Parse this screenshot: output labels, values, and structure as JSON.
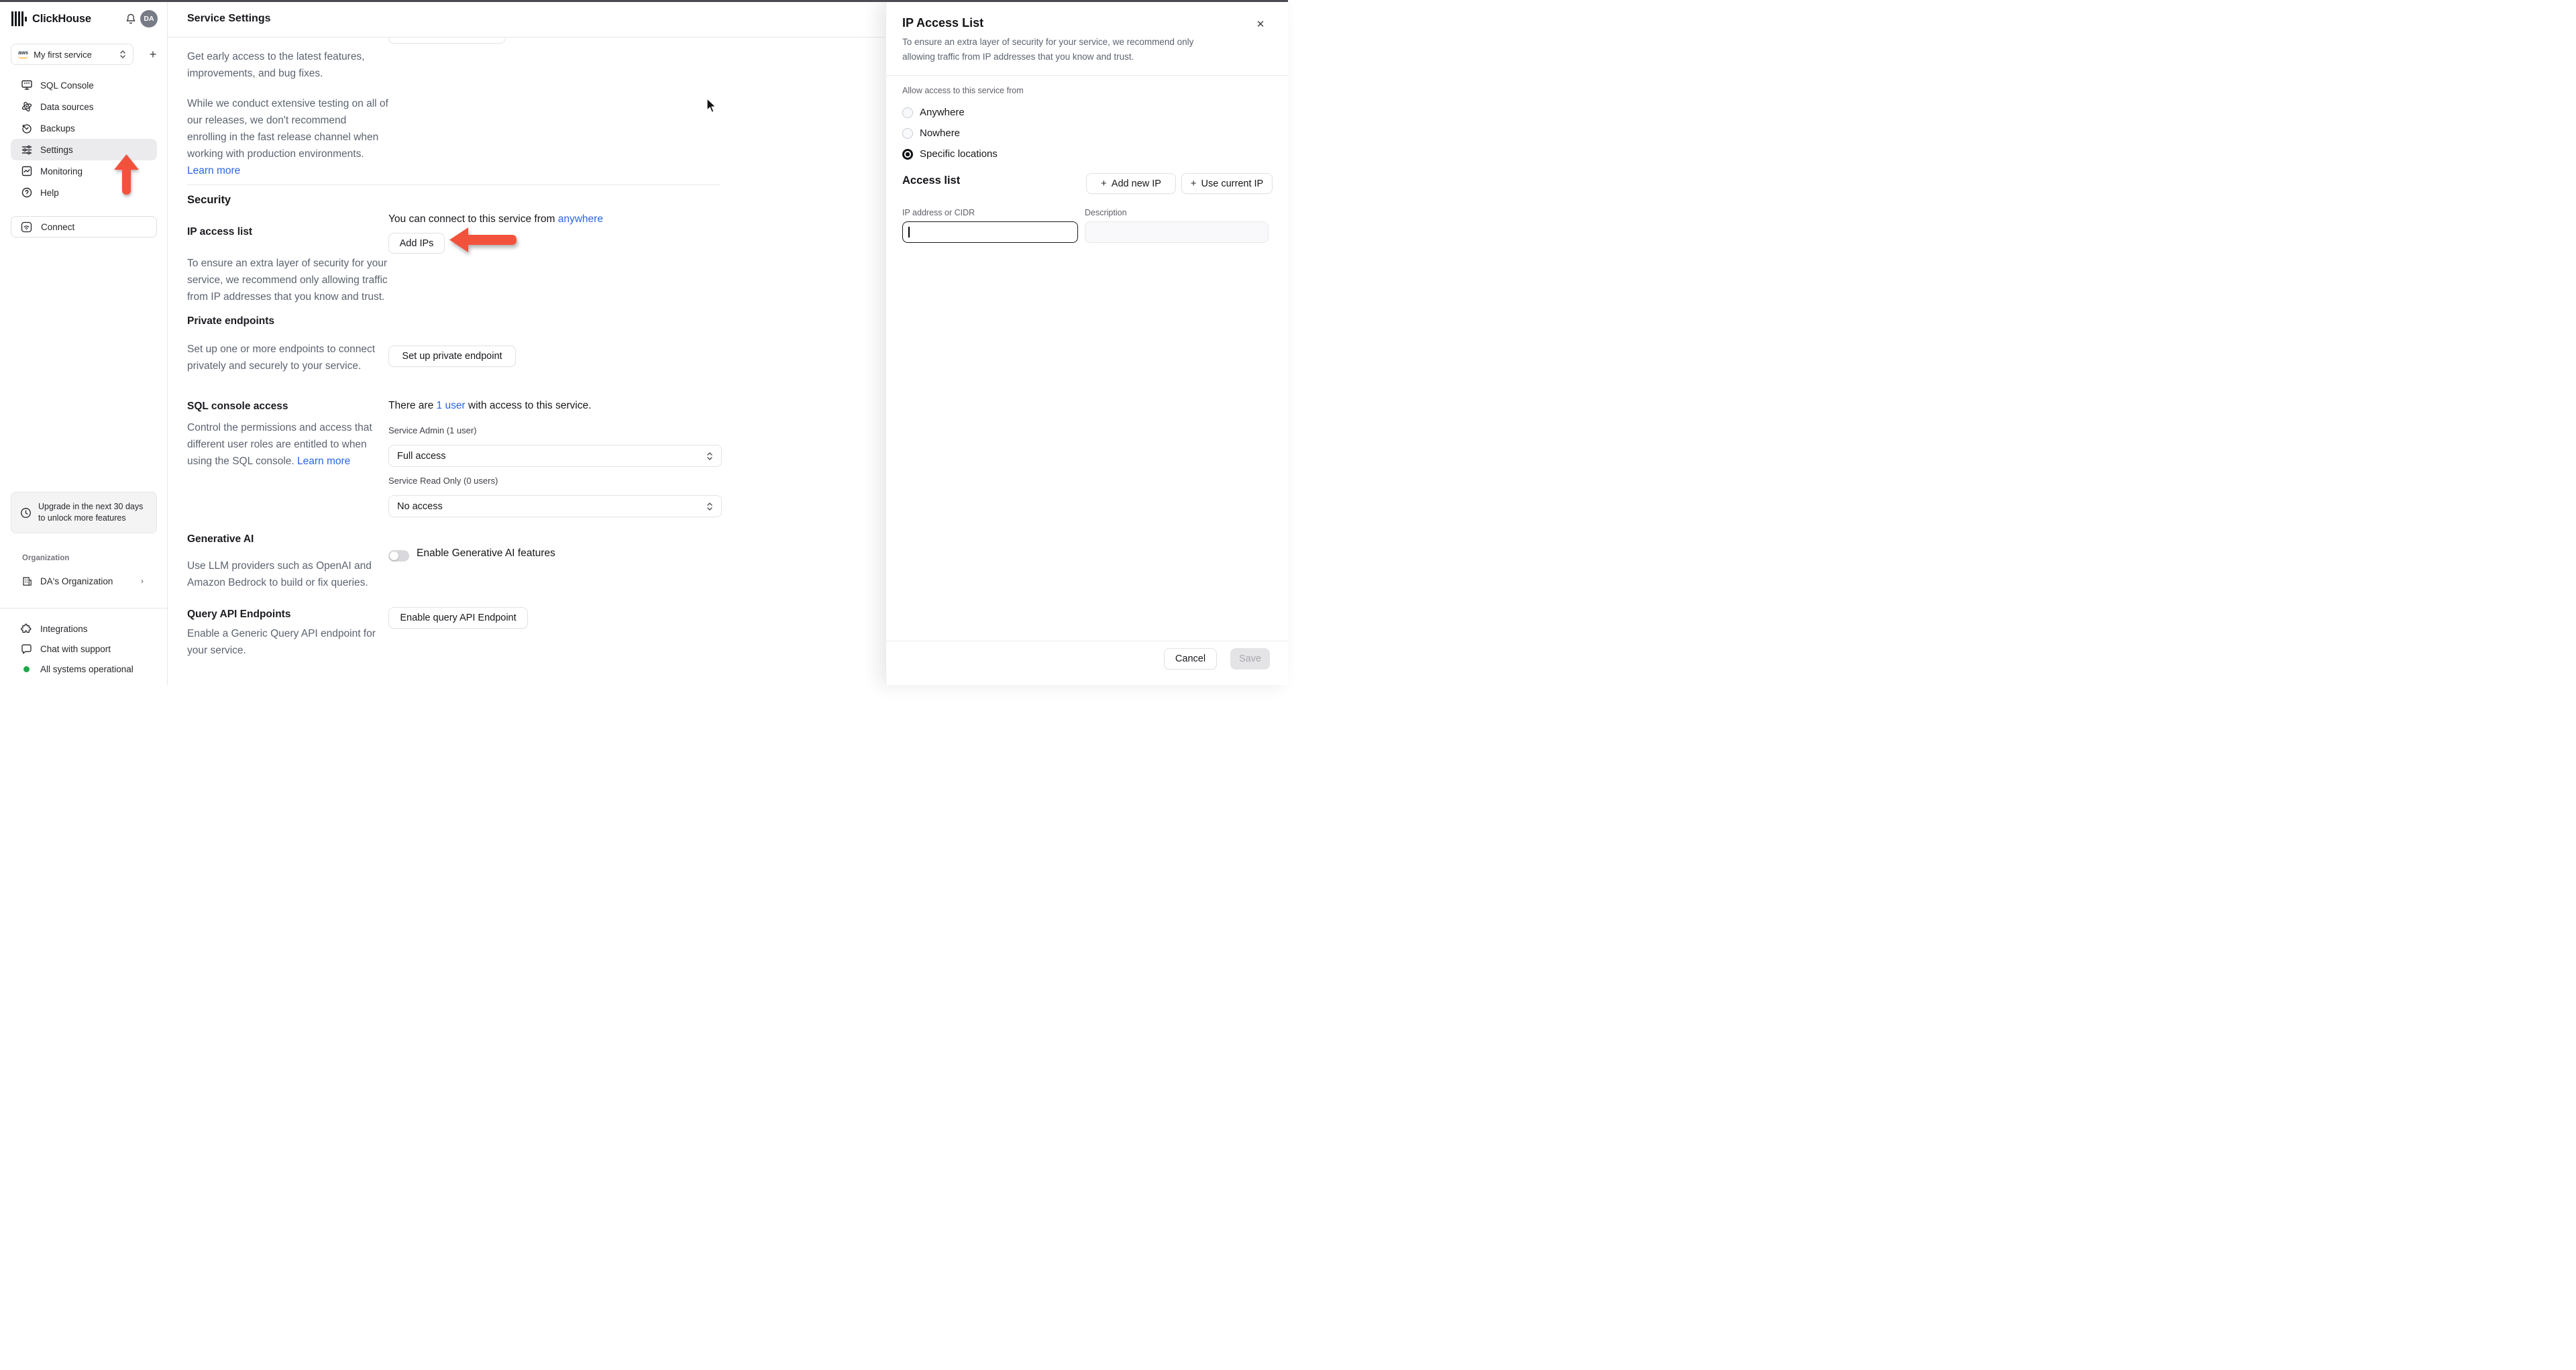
{
  "colors": {
    "accent_blue": "#2b64e5",
    "arrow_red": "#f2523c",
    "status_green": "#1fa64a",
    "highlight_gray": "#ebebee"
  },
  "sidebar": {
    "brand": "ClickHouse",
    "avatar_initials": "DA",
    "service_selector": {
      "label": "My first service",
      "provider": "aws"
    },
    "nav": [
      {
        "label": "SQL Console"
      },
      {
        "label": "Data sources"
      },
      {
        "label": "Backups"
      },
      {
        "label": "Settings"
      },
      {
        "label": "Monitoring"
      },
      {
        "label": "Help"
      }
    ],
    "connect_label": "Connect",
    "upgrade_notice": "Upgrade in the next 30 days to unlock more features",
    "organization_label": "Organization",
    "organization_name": "DA's Organization",
    "footer_items": [
      {
        "label": "Integrations"
      },
      {
        "label": "Chat with support"
      },
      {
        "label": "All systems operational"
      }
    ]
  },
  "header": {
    "title": "Service Settings"
  },
  "main": {
    "release_channel": {
      "para1": "Get early access to the latest features, improvements, and bug fixes.",
      "para2": "While we conduct extensive testing on all of our releases, we don't recommend enrolling in the fast release channel when working with production environments.",
      "learn_more": "Learn more"
    },
    "security_heading": "Security",
    "ip_access": {
      "title": "IP access list",
      "description": "To ensure an extra layer of security for your service, we recommend only allowing traffic from IP addresses that you know and trust.",
      "status_prefix": "You can connect to this service from ",
      "status_link": "anywhere",
      "button_label": "Add IPs"
    },
    "private_endpoints": {
      "title": "Private endpoints",
      "description": "Set up one or more endpoints to connect privately and securely to your service.",
      "button_label": "Set up private endpoint"
    },
    "sql_console_access": {
      "title": "SQL console access",
      "description": "Control the permissions and access that different user roles are entitled to when using the SQL console.",
      "learn_more": "Learn more",
      "status_prefix": "There are ",
      "status_link": "1 user",
      "status_suffix": " with access to this service.",
      "admin_label": "Service Admin (1 user)",
      "admin_value": "Full access",
      "readonly_label": "Service Read Only (0 users)",
      "readonly_value": "No access"
    },
    "generative_ai": {
      "title": "Generative AI",
      "description": "Use LLM providers such as OpenAI and Amazon Bedrock to build or fix queries.",
      "toggle_label": "Enable Generative AI features",
      "toggle_state": "off"
    },
    "query_api": {
      "title": "Query API Endpoints",
      "description": "Enable a Generic Query API endpoint for your service.",
      "button_label": "Enable query API Endpoint"
    }
  },
  "panel": {
    "title": "IP Access List",
    "description": "To ensure an extra layer of security for your service, we recommend only allowing traffic from IP addresses that you know and trust.",
    "allow_label": "Allow access to this service from",
    "options": [
      {
        "label": "Anywhere",
        "selected": false
      },
      {
        "label": "Nowhere",
        "selected": false
      },
      {
        "label": "Specific locations",
        "selected": true
      }
    ],
    "access_list": {
      "heading": "Access list",
      "add_new_ip": "Add new IP",
      "use_current_ip": "Use current IP",
      "ip_label": "IP address or CIDR",
      "description_label": "Description",
      "ip_value": "",
      "description_value": ""
    },
    "footer": {
      "cancel": "Cancel",
      "save": "Save"
    }
  }
}
